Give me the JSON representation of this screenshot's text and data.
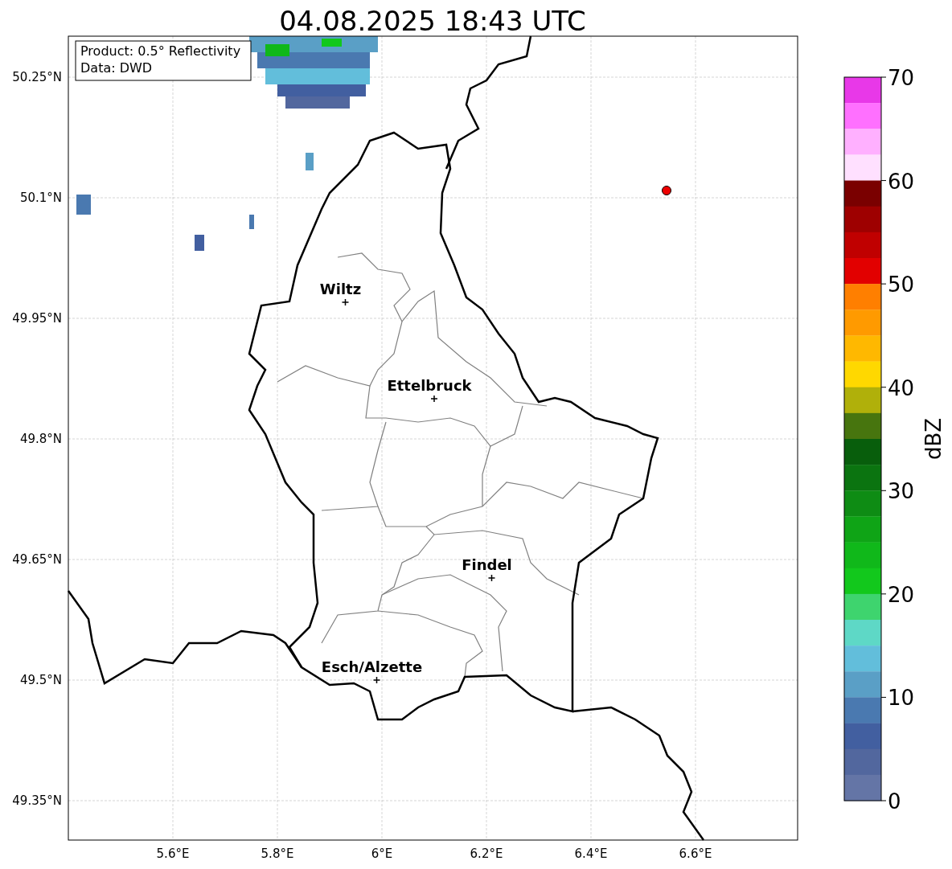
{
  "title": "04.08.2025 18:43 UTC",
  "info_box": [
    "Product: 0.5° Reflectivity",
    "Data: DWD"
  ],
  "y_ticks": [
    "50.25°N",
    "50.1°N",
    "49.95°N",
    "49.8°N",
    "49.65°N",
    "49.5°N",
    "49.35°N"
  ],
  "x_ticks": [
    "5.6°E",
    "5.8°E",
    "6°E",
    "6.2°E",
    "6.4°E",
    "6.6°E"
  ],
  "cities": [
    {
      "name": "Wiltz"
    },
    {
      "name": "Ettelbruck"
    },
    {
      "name": "Findel"
    },
    {
      "name": "Esch/Alzette"
    }
  ],
  "colorbar": {
    "label": "dBZ",
    "ticks": [
      "70",
      "60",
      "50",
      "40",
      "30",
      "20",
      "10",
      "0"
    ],
    "bins": [
      {
        "color": "#e838e8"
      },
      {
        "color": "#ff70ff"
      },
      {
        "color": "#ffb0ff"
      },
      {
        "color": "#ffe0ff"
      },
      {
        "color": "#7a0000"
      },
      {
        "color": "#9e0000"
      },
      {
        "color": "#c00000"
      },
      {
        "color": "#e20000"
      },
      {
        "color": "#ff7f00"
      },
      {
        "color": "#ff9a00"
      },
      {
        "color": "#ffb800"
      },
      {
        "color": "#ffd800"
      },
      {
        "color": "#b0b00a"
      },
      {
        "color": "#47750e"
      },
      {
        "color": "#085e0c"
      },
      {
        "color": "#0b7410"
      },
      {
        "color": "#0e8c14"
      },
      {
        "color": "#0fa416"
      },
      {
        "color": "#10b81a"
      },
      {
        "color": "#12c81c"
      },
      {
        "color": "#3ed46e"
      },
      {
        "color": "#5ed8c6"
      },
      {
        "color": "#62bedb"
      },
      {
        "color": "#5a9fc6"
      },
      {
        "color": "#4a79b0"
      },
      {
        "color": "#425fa0"
      },
      {
        "color": "#52679e"
      },
      {
        "color": "#6475a6"
      }
    ]
  }
}
